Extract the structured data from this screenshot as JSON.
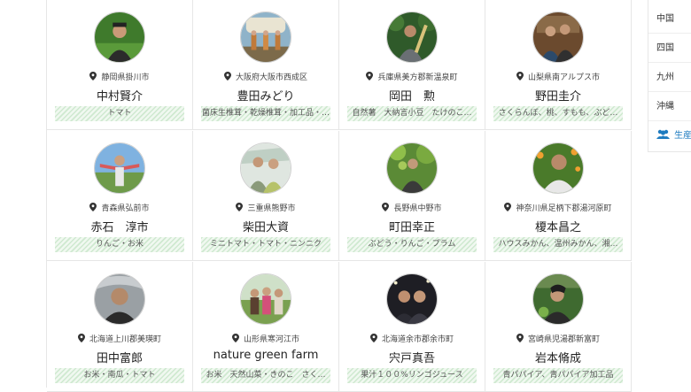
{
  "farmers": [
    {
      "location": "静岡県掛川市",
      "name": "中村賢介",
      "products": "トマト"
    },
    {
      "location": "大阪府大阪市西成区",
      "name": "豊田みどり",
      "products": "菌床生椎茸・乾燥椎茸・加工品・…"
    },
    {
      "location": "兵庫県美方郡新温泉町",
      "name": "岡田　勲",
      "products": "自然薯　大納言小豆　たけのこ…"
    },
    {
      "location": "山梨県南アルプス市",
      "name": "野田圭介",
      "products": "さくらんぼ、桃、すもも、ぶど…"
    },
    {
      "location": "青森県弘前市",
      "name": "赤石　淳市",
      "products": "りんご・お米"
    },
    {
      "location": "三重県熊野市",
      "name": "柴田大資",
      "products": "ミニトマト・トマト・ニンニク"
    },
    {
      "location": "長野県中野市",
      "name": "町田幸正",
      "products": "ぶどう・りんご・プラム"
    },
    {
      "location": "神奈川県足柄下郡湯河原町",
      "name": "榎本昌之",
      "products": "ハウスみかん、温州みかん、湘…"
    },
    {
      "location": "北海道上川郡美瑛町",
      "name": "田中富郎",
      "products": "お米・南瓜・トマト"
    },
    {
      "location": "山形県寒河江市",
      "name": "nature green farm",
      "products": "お米　天然山菜・きのこ　さく…"
    },
    {
      "location": "北海道余市郡余市町",
      "name": "宍戸真吾",
      "products": "果汁１００%リンゴジュース"
    },
    {
      "location": "宮崎県児湯郡新富町",
      "name": "岩本脩成",
      "products": "青パパイア、青パパイア加工品"
    }
  ],
  "sidebar": {
    "regions": [
      "中国",
      "四国",
      "九州",
      "沖縄"
    ],
    "producer_link": "生産者"
  },
  "colors": {
    "tag_stripe": "#cfe9d0",
    "link_blue": "#1f7cc0"
  }
}
